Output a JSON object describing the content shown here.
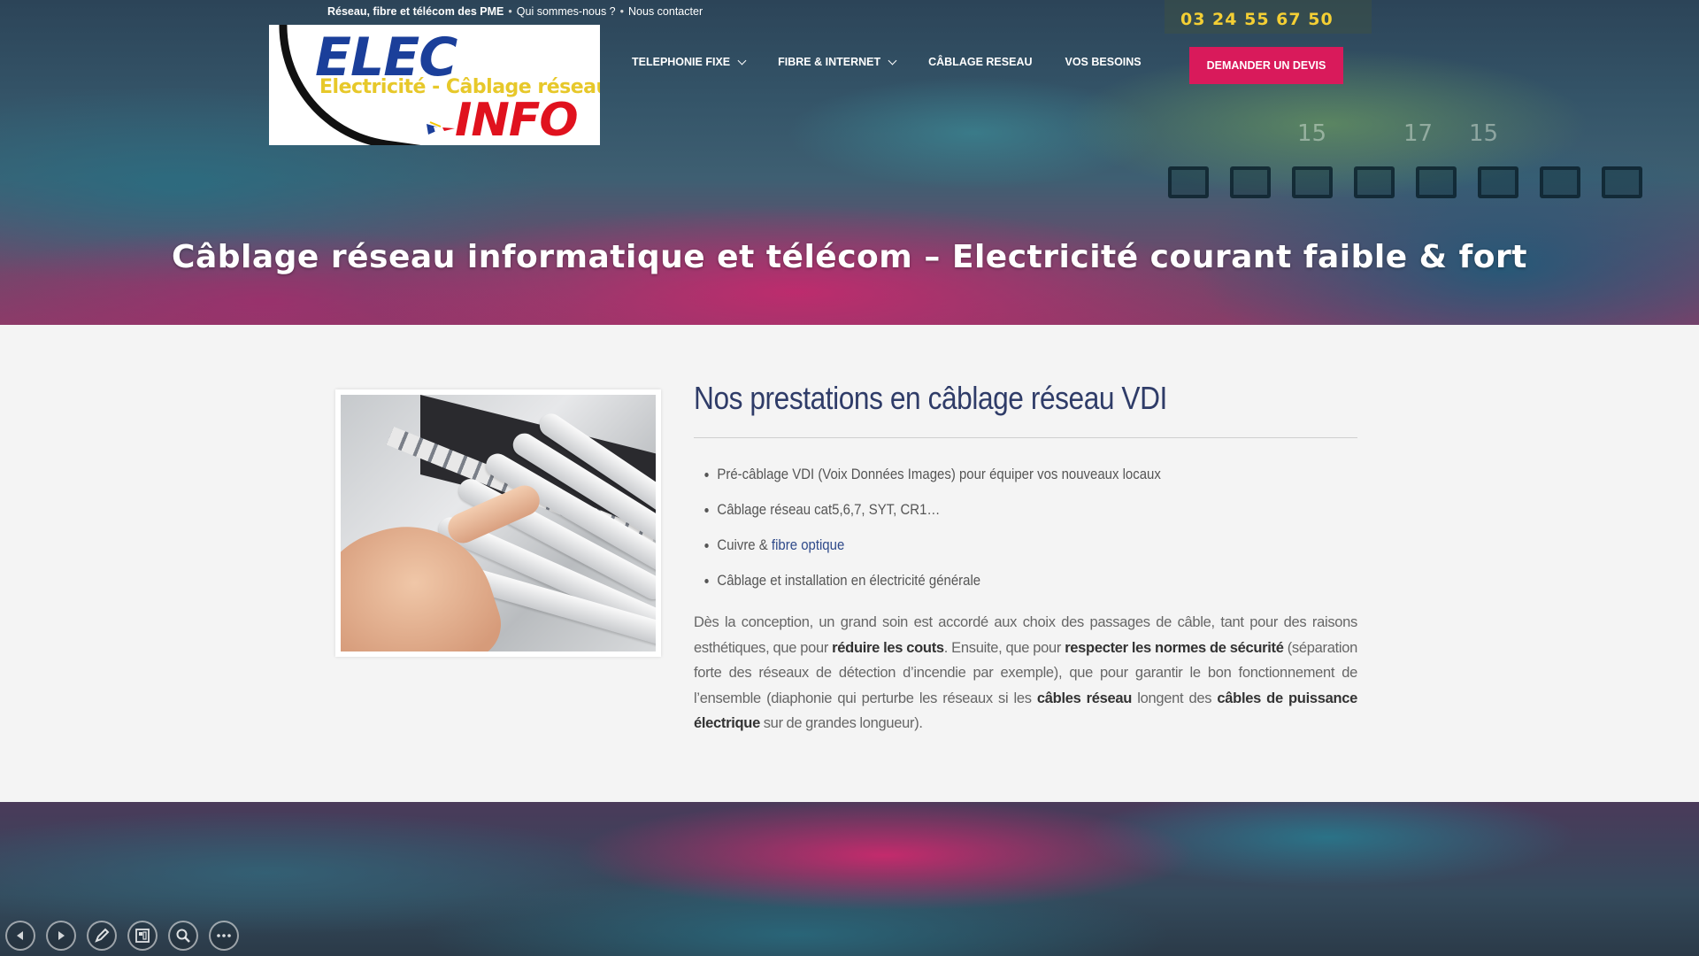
{
  "topbar": {
    "tagline": "Réseau, fibre et télécom des PME",
    "about_link": "Qui sommes-nous ?",
    "contact_link": "Nous contacter"
  },
  "phone": "03 24 55 67 50",
  "logo": {
    "line1": "ELEC",
    "line2": "Electricité - Câblage réseau",
    "line3": "INFO"
  },
  "nav": {
    "items": [
      {
        "label": "TELEPHONIE FIXE",
        "dropdown": true
      },
      {
        "label": "FIBRE & INTERNET",
        "dropdown": true
      },
      {
        "label": "CÂBLAGE RESEAU",
        "dropdown": false
      },
      {
        "label": "VOS BESOINS",
        "dropdown": false
      }
    ],
    "cta_label": "DEMANDER UN DEVIS"
  },
  "hero": {
    "title": "Câblage réseau informatique et télécom – Electricité courant faible & fort",
    "port_numbers": [
      "15",
      "17",
      "15"
    ]
  },
  "main": {
    "heading": "Nos prestations en câblage réseau VDI",
    "list": {
      "item1": "Pré-câblage VDI (Voix Données Images) pour équiper vos nouveaux locaux",
      "item2": "Câblage réseau cat5,6,7, SYT, CR1…",
      "item3_prefix": "Cuivre & ",
      "item3_link": "fibre optique",
      "item4": "Câblage et installation en électricité générale"
    },
    "paragraph": {
      "t1": "Dès la conception, un grand soin est accordé aux choix des passages de câble, tant pour des raisons esthétiques, que pour ",
      "b1": "réduire les couts",
      "t2": ". Ensuite, que pour ",
      "b2": "respecter les normes de sécurité",
      "t3": " (séparation forte des réseaux de détection d’incendie par exemple), que pour garantir le bon fonctionnement de l’ensemble (diaphonie qui perturbe les réseaux si les ",
      "b3": "câbles réseau",
      "t4": " longent des ",
      "b4": "câbles de puissance électrique",
      "t5": " sur de grandes longueur)."
    }
  },
  "colors": {
    "accent": "#d91a5b",
    "phone": "#f4cf34",
    "heading": "#2f3c68",
    "link": "#2f4a8a"
  },
  "controls": [
    "previous-icon",
    "next-icon",
    "pen-icon",
    "layout-icon",
    "zoom-icon",
    "more-icon"
  ]
}
